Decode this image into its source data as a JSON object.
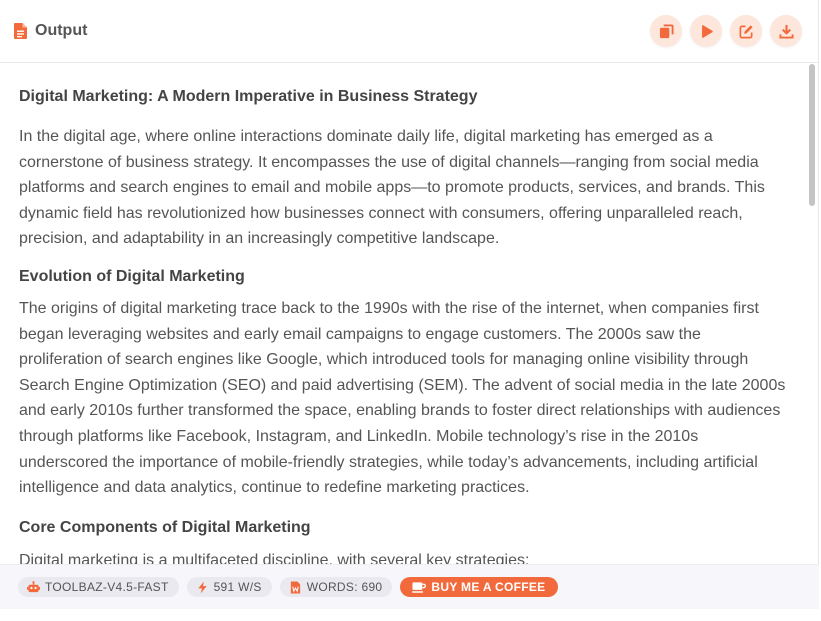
{
  "header": {
    "title": "Output",
    "icons": [
      "document-icon",
      "copy-icon",
      "play-icon",
      "edit-icon",
      "download-icon"
    ],
    "accent_color": "#f26a3c",
    "button_bg": "#fde7dc"
  },
  "content": {
    "title": "Digital Marketing: A Modern Imperative in Business Strategy",
    "intro": "In the digital age, where online interactions dominate daily life, digital marketing has emerged as a cornerstone of business strategy. It encompasses the use of digital channels—ranging from social media platforms and search engines to email and mobile apps—to promote products, services, and brands. This dynamic field has revolutionized how businesses connect with consumers, offering unparalleled reach, precision, and adaptability in an increasingly competitive landscape.",
    "section1_heading": "Evolution of Digital Marketing",
    "section1_body": "The origins of digital marketing trace back to the 1990s with the rise of the internet, when companies first began leveraging websites and early email campaigns to engage customers. The 2000s saw the proliferation of search engines like Google, which introduced tools for managing online visibility through Search Engine Optimization (SEO) and paid advertising (SEM). The advent of social media in the late 2000s and early 2010s further transformed the space, enabling brands to foster direct relationships with audiences through platforms like Facebook, Instagram, and LinkedIn. Mobile technology’s rise in the 2010s underscored the importance of mobile-friendly strategies, while today’s advancements, including artificial intelligence and data analytics, continue to redefine marketing practices.",
    "section2_heading": "Core Components of Digital Marketing",
    "section2_body": "Digital marketing is a multifaceted discipline, with several key strategies:"
  },
  "footer": {
    "model": "TOOLBAZ-V4.5-FAST",
    "speed": "591 W/S",
    "words": "WORDS: 690",
    "coffee": "BUY ME A COFFEE",
    "icons": [
      "robot-icon",
      "lightning-icon",
      "word-file-icon",
      "coffee-cup-icon"
    ]
  }
}
